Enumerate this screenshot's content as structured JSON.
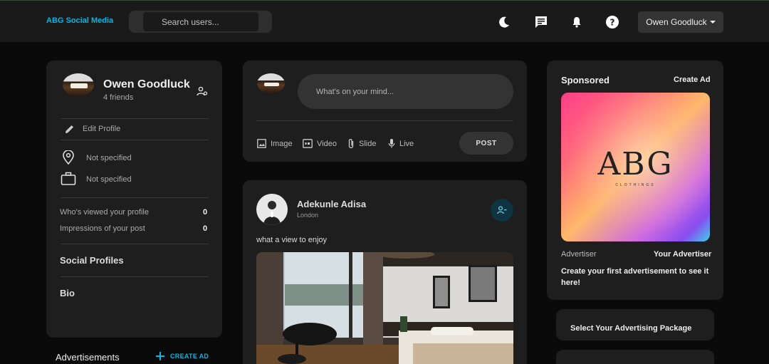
{
  "navbar": {
    "brand": "ABG Social Media",
    "search_placeholder": "Search users...",
    "icons": [
      "moon-icon",
      "chat-icon",
      "bell-icon",
      "help-icon"
    ],
    "user_name": "Owen Goodluck"
  },
  "profile": {
    "name": "Owen Goodluck",
    "friends": "4 friends",
    "edit_label": "Edit Profile",
    "location": "Not specified",
    "occupation": "Not specified",
    "viewed_label": "Who's viewed your profile",
    "viewed_count": "0",
    "impressions_label": "Impressions of your post",
    "impressions_count": "0",
    "social_label": "Social Profiles",
    "bio_label": "Bio"
  },
  "advertisements": {
    "title": "Advertisements",
    "create_label": "CREATE AD"
  },
  "composer": {
    "placeholder": "What's on your mind...",
    "actions": [
      "Image",
      "Video",
      "Slide",
      "Live"
    ],
    "post_label": "POST"
  },
  "post": {
    "author": "Adekunle Adisa",
    "location": "London",
    "text": "what a view to enjoy"
  },
  "sponsored": {
    "title": "Sponsored",
    "create_label": "Create Ad",
    "ad_logo": "ABG",
    "ad_logo_sub": "CLOTHINGS",
    "advertiser_label": "Advertiser",
    "advertiser_value": "Your Advertiser",
    "message": "Create your first advertisement to see it here!"
  },
  "package": {
    "label": "Select Your Advertising Package"
  },
  "colors": {
    "accent": "#00b8e6",
    "background": "#0a0a0a",
    "card": "#1e1e1e"
  }
}
